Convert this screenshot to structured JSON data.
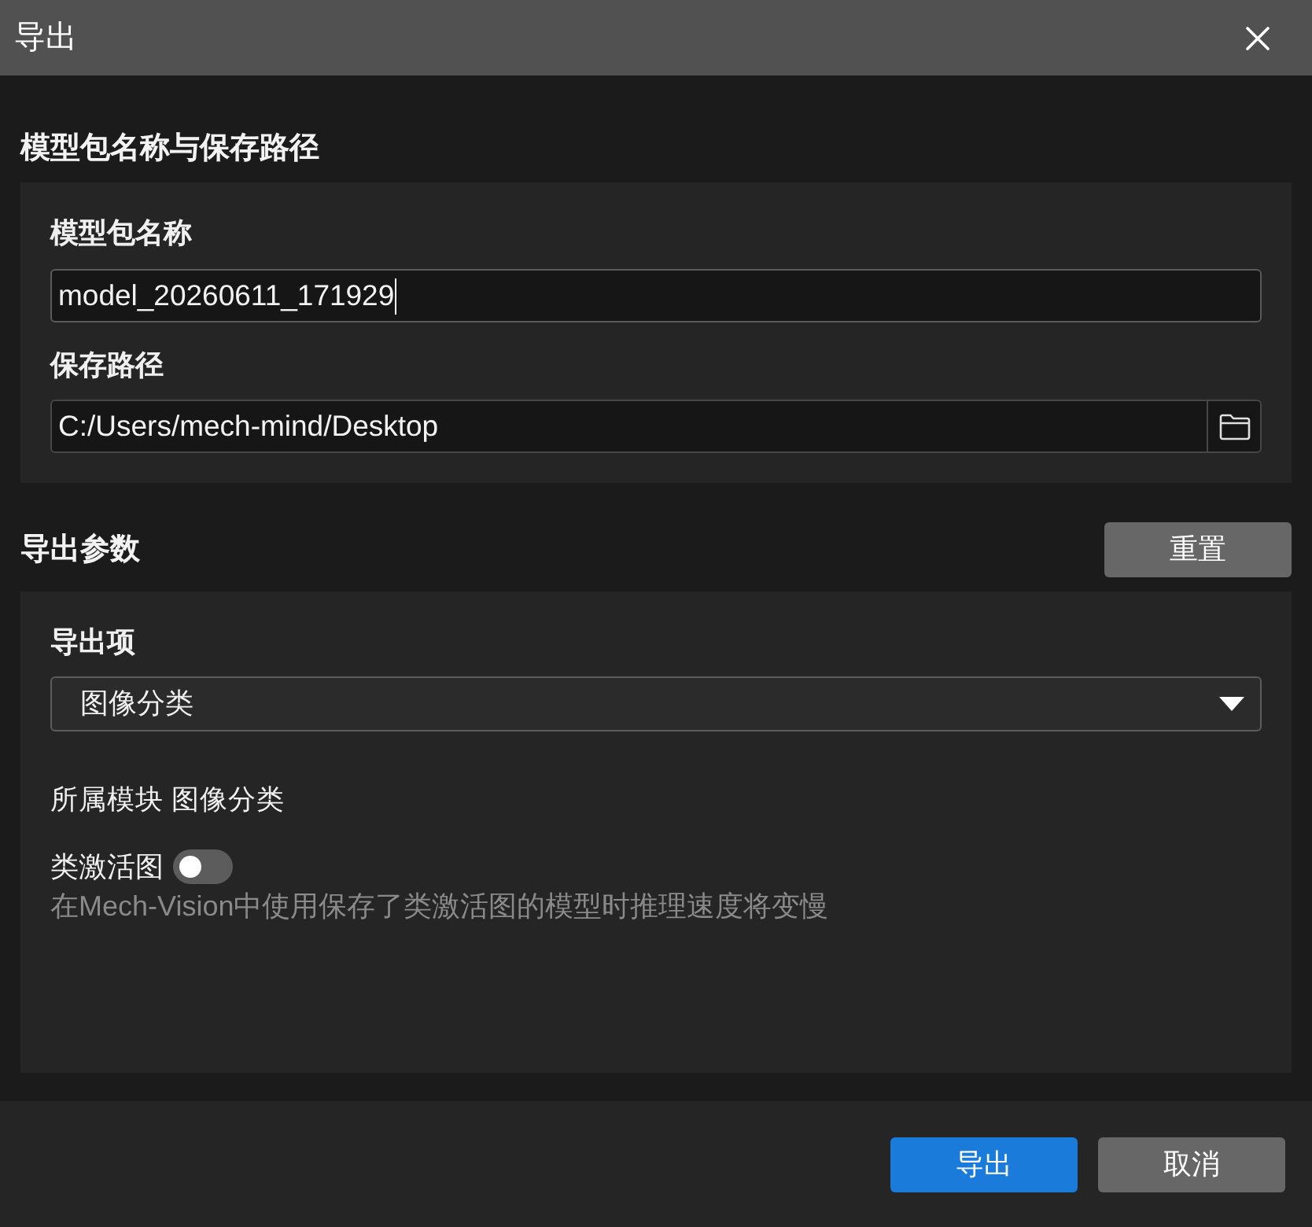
{
  "window": {
    "title": "导出"
  },
  "name_and_path": {
    "heading": "模型包名称与保存路径",
    "fields": [
      {
        "kind": "text",
        "label": "模型包名称",
        "value": "model_20260611_171929",
        "focused": true
      },
      {
        "kind": "path",
        "label": "保存路径",
        "value": "C:/Users/mech-mind/Desktop",
        "focused": false
      }
    ]
  },
  "export_params": {
    "heading": "导出参数",
    "reset_button": "重置",
    "export_item": {
      "label": "导出项",
      "value": "图像分类"
    },
    "module": {
      "label": "所属模块",
      "value": "图像分类"
    },
    "class_activation_map": {
      "label": "类激活图",
      "on": false,
      "hint": "在Mech-Vision中使用保存了类激活图的模型时推理速度将变慢"
    }
  },
  "footer": {
    "buttons": [
      {
        "label": "导出",
        "kind": "primary"
      },
      {
        "label": "取消",
        "kind": "secondary"
      }
    ]
  }
}
